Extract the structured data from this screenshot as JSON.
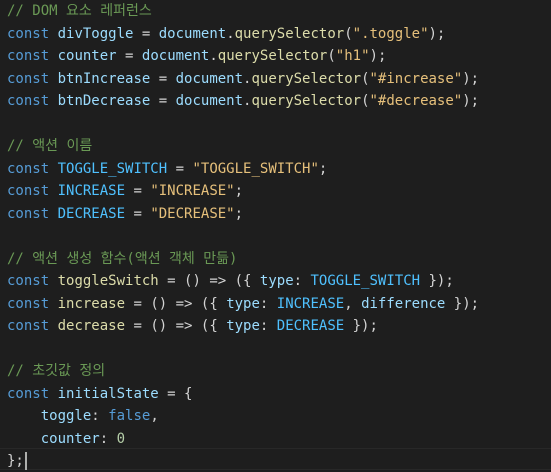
{
  "editor": {
    "lines": [
      [
        {
          "t": "// DOM 요소 레퍼런스",
          "c": "comment"
        }
      ],
      [
        {
          "t": "const",
          "c": "keyword"
        },
        {
          "t": " ",
          "c": "plain"
        },
        {
          "t": "divToggle",
          "c": "variable"
        },
        {
          "t": " = ",
          "c": "op"
        },
        {
          "t": "document",
          "c": "variable"
        },
        {
          "t": ".",
          "c": "punct"
        },
        {
          "t": "querySelector",
          "c": "func"
        },
        {
          "t": "(",
          "c": "punct"
        },
        {
          "t": "\".toggle\"",
          "c": "string-y"
        },
        {
          "t": ");",
          "c": "punct"
        }
      ],
      [
        {
          "t": "const",
          "c": "keyword"
        },
        {
          "t": " ",
          "c": "plain"
        },
        {
          "t": "counter",
          "c": "variable"
        },
        {
          "t": " = ",
          "c": "op"
        },
        {
          "t": "document",
          "c": "variable"
        },
        {
          "t": ".",
          "c": "punct"
        },
        {
          "t": "querySelector",
          "c": "func"
        },
        {
          "t": "(",
          "c": "punct"
        },
        {
          "t": "\"h1\"",
          "c": "string-y"
        },
        {
          "t": ");",
          "c": "punct"
        }
      ],
      [
        {
          "t": "const",
          "c": "keyword"
        },
        {
          "t": " ",
          "c": "plain"
        },
        {
          "t": "btnIncrease",
          "c": "variable"
        },
        {
          "t": " = ",
          "c": "op"
        },
        {
          "t": "document",
          "c": "variable"
        },
        {
          "t": ".",
          "c": "punct"
        },
        {
          "t": "querySelector",
          "c": "func"
        },
        {
          "t": "(",
          "c": "punct"
        },
        {
          "t": "\"#increase\"",
          "c": "string-y"
        },
        {
          "t": ");",
          "c": "punct"
        }
      ],
      [
        {
          "t": "const",
          "c": "keyword"
        },
        {
          "t": " ",
          "c": "plain"
        },
        {
          "t": "btnDecrease",
          "c": "variable"
        },
        {
          "t": " = ",
          "c": "op"
        },
        {
          "t": "document",
          "c": "variable"
        },
        {
          "t": ".",
          "c": "punct"
        },
        {
          "t": "querySelector",
          "c": "func"
        },
        {
          "t": "(",
          "c": "punct"
        },
        {
          "t": "\"#decrease\"",
          "c": "string-y"
        },
        {
          "t": ");",
          "c": "punct"
        }
      ],
      [],
      [
        {
          "t": "// 액션 이름",
          "c": "comment"
        }
      ],
      [
        {
          "t": "const",
          "c": "keyword"
        },
        {
          "t": " ",
          "c": "plain"
        },
        {
          "t": "TOGGLE_SWITCH",
          "c": "constant"
        },
        {
          "t": " = ",
          "c": "op"
        },
        {
          "t": "\"TOGGLE_SWITCH\"",
          "c": "string-y"
        },
        {
          "t": ";",
          "c": "punct"
        }
      ],
      [
        {
          "t": "const",
          "c": "keyword"
        },
        {
          "t": " ",
          "c": "plain"
        },
        {
          "t": "INCREASE",
          "c": "constant"
        },
        {
          "t": " = ",
          "c": "op"
        },
        {
          "t": "\"INCREASE\"",
          "c": "string-y"
        },
        {
          "t": ";",
          "c": "punct"
        }
      ],
      [
        {
          "t": "const",
          "c": "keyword"
        },
        {
          "t": " ",
          "c": "plain"
        },
        {
          "t": "DECREASE",
          "c": "constant"
        },
        {
          "t": " = ",
          "c": "op"
        },
        {
          "t": "\"DECREASE\"",
          "c": "string-y"
        },
        {
          "t": ";",
          "c": "punct"
        }
      ],
      [],
      [
        {
          "t": "// 액션 생성 함수(액션 객체 만듦)",
          "c": "comment"
        }
      ],
      [
        {
          "t": "const",
          "c": "keyword"
        },
        {
          "t": " ",
          "c": "plain"
        },
        {
          "t": "toggleSwitch",
          "c": "func"
        },
        {
          "t": " = () => ({ ",
          "c": "op"
        },
        {
          "t": "type",
          "c": "property"
        },
        {
          "t": ": ",
          "c": "punct"
        },
        {
          "t": "TOGGLE_SWITCH",
          "c": "constant"
        },
        {
          "t": " });",
          "c": "punct"
        }
      ],
      [
        {
          "t": "const",
          "c": "keyword"
        },
        {
          "t": " ",
          "c": "plain"
        },
        {
          "t": "increase",
          "c": "func"
        },
        {
          "t": " = () => ({ ",
          "c": "op"
        },
        {
          "t": "type",
          "c": "property"
        },
        {
          "t": ": ",
          "c": "punct"
        },
        {
          "t": "INCREASE",
          "c": "constant"
        },
        {
          "t": ", ",
          "c": "punct"
        },
        {
          "t": "difference",
          "c": "property"
        },
        {
          "t": " });",
          "c": "punct"
        }
      ],
      [
        {
          "t": "const",
          "c": "keyword"
        },
        {
          "t": " ",
          "c": "plain"
        },
        {
          "t": "decrease",
          "c": "func"
        },
        {
          "t": " = () => ({ ",
          "c": "op"
        },
        {
          "t": "type",
          "c": "property"
        },
        {
          "t": ": ",
          "c": "punct"
        },
        {
          "t": "DECREASE",
          "c": "constant"
        },
        {
          "t": " });",
          "c": "punct"
        }
      ],
      [],
      [
        {
          "t": "// 초깃값 정의",
          "c": "comment"
        }
      ],
      [
        {
          "t": "const",
          "c": "keyword"
        },
        {
          "t": " ",
          "c": "plain"
        },
        {
          "t": "initialState",
          "c": "variable"
        },
        {
          "t": " = {",
          "c": "op"
        }
      ],
      [
        {
          "t": "    ",
          "c": "plain"
        },
        {
          "t": "toggle",
          "c": "property"
        },
        {
          "t": ": ",
          "c": "punct"
        },
        {
          "t": "false",
          "c": "keyword"
        },
        {
          "t": ",",
          "c": "punct"
        }
      ],
      [
        {
          "t": "    ",
          "c": "plain"
        },
        {
          "t": "counter",
          "c": "property"
        },
        {
          "t": ": ",
          "c": "punct"
        },
        {
          "t": "0",
          "c": "number"
        }
      ],
      [
        {
          "t": "};",
          "c": "punct"
        }
      ]
    ],
    "cursor_line": 20
  }
}
